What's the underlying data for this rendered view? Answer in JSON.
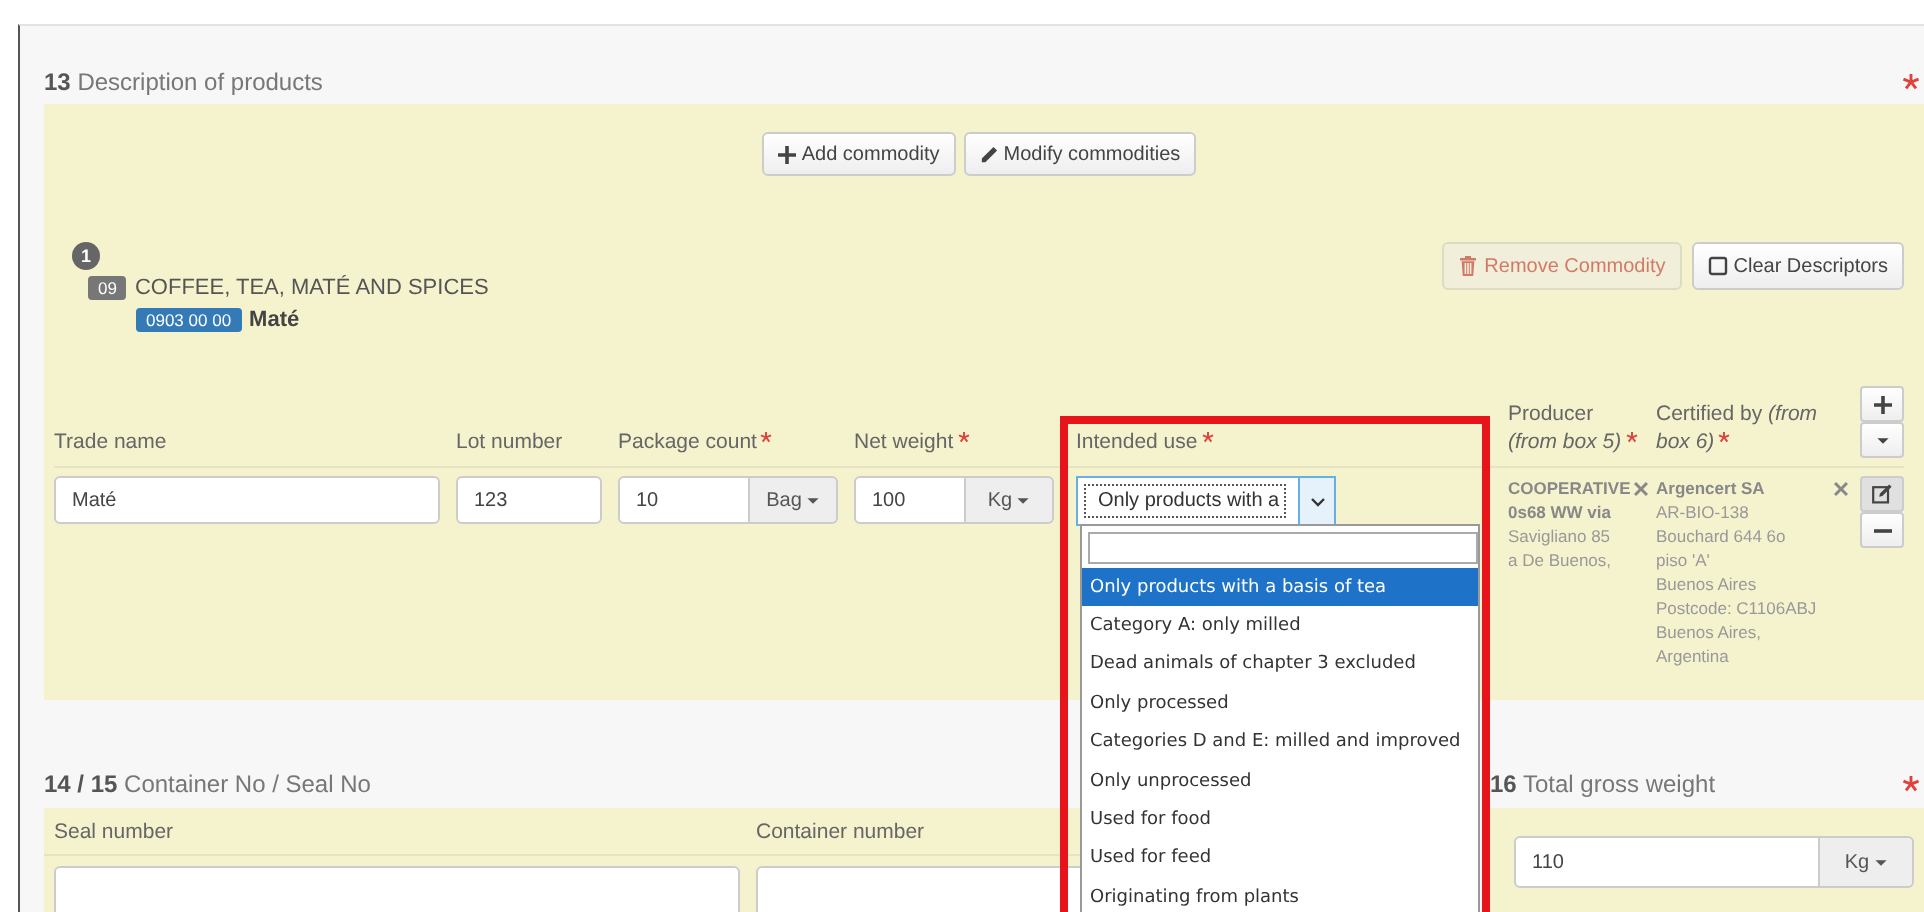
{
  "section_13": {
    "number": "13",
    "title": "Description of products",
    "required": true,
    "buttons": [
      {
        "label": "Add commodity"
      },
      {
        "label": "Modify commodities"
      }
    ],
    "commodity": {
      "index": "1",
      "chapter_code": "09",
      "chapter_name": "COFFEE, TEA, MATÉ AND SPICES",
      "cn_code": "0903 00 00",
      "name": "Maté",
      "actions": [
        {
          "label": "Remove Commodity",
          "disabled": true
        },
        {
          "label": "Clear Descriptors",
          "disabled": false
        }
      ]
    },
    "table": {
      "columns": [
        {
          "label": "Trade name",
          "required": false
        },
        {
          "label": "Lot number",
          "required": false
        },
        {
          "label": "Package count",
          "required": true
        },
        {
          "label": "Net weight",
          "required": true
        },
        {
          "label": "Intended use",
          "required": true
        },
        {
          "label": "Producer",
          "hint": "(from box 5)",
          "required": true
        },
        {
          "label": "Certified by",
          "hint": "(from box 6)",
          "required": true
        }
      ],
      "rows": [
        {
          "trade_name": "Maté",
          "lot_number": "123",
          "package_count": "10",
          "package_unit": "Bag",
          "net_weight": "100",
          "weight_unit": "Kg",
          "intended_use": {
            "value": "Only products with a",
            "expanded": true,
            "options": [
              {
                "label": "Only products with a basis of tea",
                "selected": true
              },
              {
                "label": "Category A: only milled",
                "selected": false
              },
              {
                "label": "Dead animals of chapter 3 excluded",
                "selected": false
              },
              {
                "label": "Only processed",
                "selected": false
              },
              {
                "label": "Categories D and E: milled and improved",
                "selected": false
              },
              {
                "label": "Only unprocessed",
                "selected": false
              },
              {
                "label": "Used for food",
                "selected": false
              },
              {
                "label": "Used for feed",
                "selected": false
              },
              {
                "label": "Originating from plants",
                "selected": false
              }
            ]
          },
          "producer": {
            "name": "COOPERATIVE0s68 WW via",
            "lines": [
              "Savigliano 85",
              "a De Buenos,"
            ]
          },
          "certified_by": {
            "name": "Argencert SA",
            "lines": [
              "AR-BIO-138",
              "Bouchard 644 6o",
              "piso 'A'",
              "Buenos Aires",
              "Postcode: C1106ABJ",
              "Buenos Aires,",
              "Argentina"
            ]
          }
        }
      ]
    }
  },
  "section_14_15": {
    "number": "14 / 15",
    "title": "Container No / Seal No",
    "columns": [
      "Seal number",
      "Container number"
    ]
  },
  "section_16": {
    "number": "16",
    "title": "Total gross weight",
    "required": true,
    "value": "110",
    "unit": "Kg"
  }
}
